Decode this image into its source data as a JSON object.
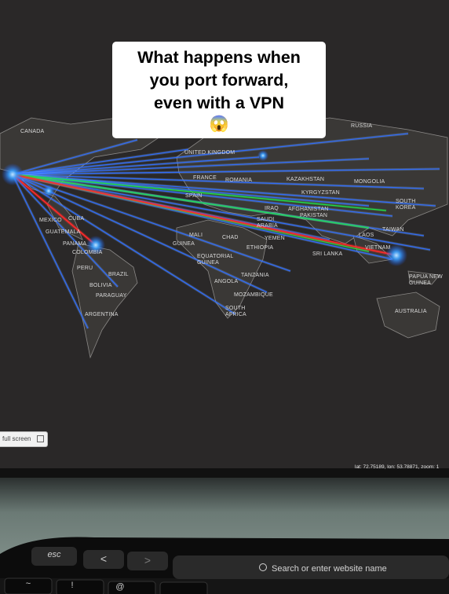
{
  "caption": {
    "line1": "What happens when",
    "line2": "you port forward,",
    "line3": "even with a VPN",
    "emoji": "😱"
  },
  "map": {
    "countries": {
      "canada": "CANADA",
      "russia": "RUSSIA",
      "united_kingdom": "UNITED KINGDOM",
      "france": "FRANCE",
      "romania": "ROMANIA",
      "kazakhstan": "KAZAKHSTAN",
      "mongolia": "MONGOLIA",
      "kyrgyzstan": "KYRGYZSTAN",
      "south_korea": "SOUTH KOREA",
      "spain": "SPAIN",
      "iraq": "IRAQ",
      "afghanistan": "AFGHANISTAN",
      "pakistan": "PAKISTAN",
      "saudi_arabia": "SAUDI ARABIA",
      "taiwan": "TAIWAN",
      "laos": "LAOS",
      "cuba": "CUBA",
      "mexico": "MEXICO",
      "guatemala": "GUATEMALA",
      "panama": "PANAMA",
      "colombia": "COLOMBIA",
      "mali": "MALI",
      "chad": "CHAD",
      "yemen": "YEMEN",
      "ethiopia": "ETHIOPIA",
      "guinea": "GUINEA",
      "equatorial_guinea": "EQUATORIAL GUINEA",
      "sri_lanka": "SRI LANKA",
      "vietnam": "VIETNAM",
      "peru": "PERU",
      "brazil": "BRAZIL",
      "bolivia": "BOLIVIA",
      "paraguay": "PARAGUAY",
      "argentina": "ARGENTINA",
      "tanzania": "TANZANIA",
      "angola": "ANGOLA",
      "mozambique": "MOZAMBIQUE",
      "south_africa": "SOUTH AFRICA",
      "papua_new_guinea": "PAPUA NEW GUINEA",
      "australia": "AUSTRALIA"
    },
    "full_screen_label": "full screen",
    "coordinates_text": "lat: 72.75189, lon: 53.78871, zoom: 1"
  },
  "keyboard": {
    "esc": "esc",
    "back": "<",
    "forward": ">",
    "search_placeholder": "Search or enter website name",
    "tilde": "~",
    "exclaim": "!",
    "at": "@"
  },
  "colors": {
    "map_bg": "#2a2828",
    "land": "#3c3a38",
    "border": "#8a8886",
    "line_blue": "#2f6bff",
    "line_red": "#ff2a2a",
    "line_green": "#22e04a",
    "node_glow": "#3aa0ff",
    "laptop_body": "#7f8f8a",
    "touchbar": "#101010"
  }
}
